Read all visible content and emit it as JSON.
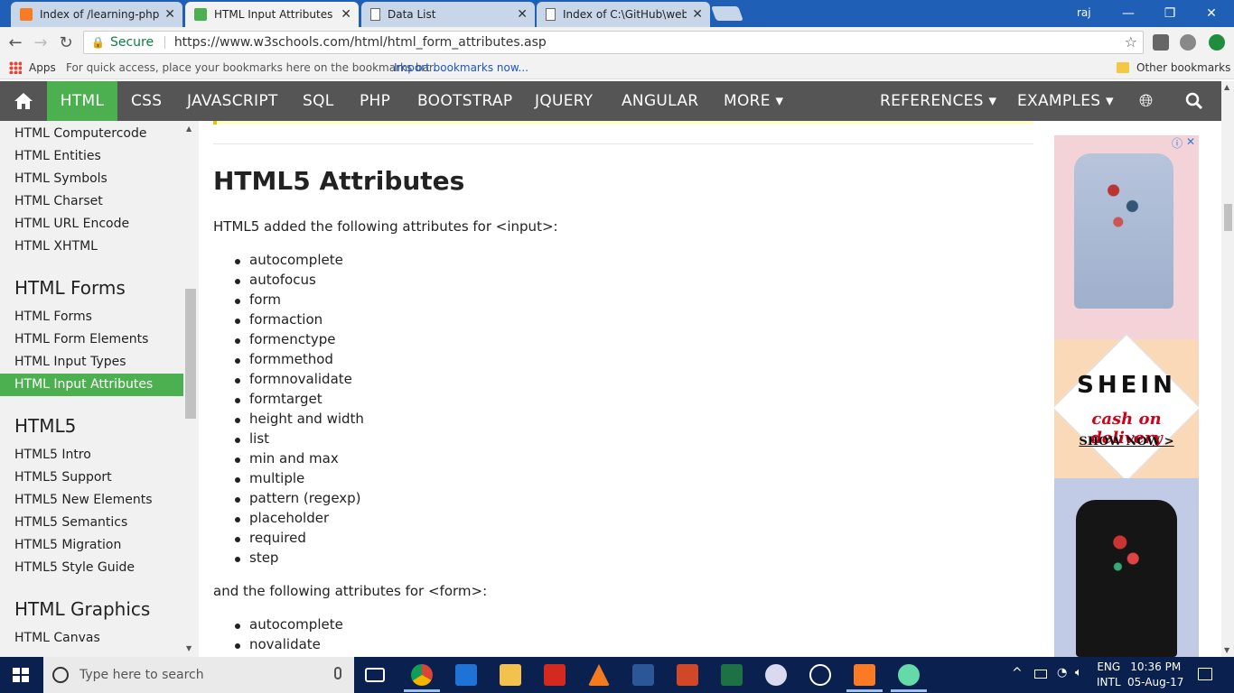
{
  "browser": {
    "tabs": [
      {
        "title": "Index of /learning-php/c",
        "icon": "xampp-icon"
      },
      {
        "title": "HTML Input Attributes",
        "icon": "w3schools-icon"
      },
      {
        "title": "Data List",
        "icon": "page-icon"
      },
      {
        "title": "Index of C:\\GitHub\\web-",
        "icon": "page-icon"
      }
    ],
    "close_glyph": "✕",
    "user": "raj",
    "secure_label": "Secure",
    "url": "https://www.w3schools.com/html/html_form_attributes.asp",
    "bookmarks": {
      "apps": "Apps",
      "hint": "For quick access, place your bookmarks here on the bookmarks bar.",
      "import": "Import bookmarks now...",
      "other": "Other bookmarks"
    }
  },
  "nav": {
    "items": [
      "HTML",
      "CSS",
      "JAVASCRIPT",
      "SQL",
      "PHP",
      "BOOTSTRAP",
      "JQUERY",
      "ANGULAR",
      "MORE ▾"
    ],
    "right": [
      "REFERENCES ▾",
      "EXAMPLES ▾"
    ],
    "accent": "#4caf50"
  },
  "sidebar": {
    "links_top": [
      "HTML Computercode",
      "HTML Entities",
      "HTML Symbols",
      "HTML Charset",
      "HTML URL Encode",
      "HTML XHTML"
    ],
    "forms_heading": "HTML Forms",
    "forms_links": [
      "HTML Forms",
      "HTML Form Elements",
      "HTML Input Types",
      "HTML Input Attributes"
    ],
    "html5_heading": "HTML5",
    "html5_links": [
      "HTML5 Intro",
      "HTML5 Support",
      "HTML5 New Elements",
      "HTML5 Semantics",
      "HTML5 Migration",
      "HTML5 Style Guide"
    ],
    "graphics_heading": "HTML Graphics",
    "graphics_links": [
      "HTML Canvas"
    ]
  },
  "main": {
    "heading": "HTML5 Attributes",
    "intro_input": "HTML5 added the following attributes for <input>:",
    "input_attrs": [
      "autocomplete",
      "autofocus",
      "form",
      "formaction",
      "formenctype",
      "formmethod",
      "formnovalidate",
      "formtarget",
      "height and width",
      "list",
      "min and max",
      "multiple",
      "pattern (regexp)",
      "placeholder",
      "required",
      "step"
    ],
    "intro_form": "and the following attributes for <form>:",
    "form_attrs": [
      "autocomplete",
      "novalidate"
    ]
  },
  "ad": {
    "brand": "SHEIN",
    "tagline": "cash on delivery",
    "cta": "SHOW NOW >",
    "info_glyph": "ⓘ",
    "close_glyph": "✕"
  },
  "taskbar": {
    "search_placeholder": "Type here to search",
    "lang_top": "ENG",
    "lang_bottom": "INTL",
    "time": "10:36 PM",
    "date": "05-Aug-17"
  }
}
